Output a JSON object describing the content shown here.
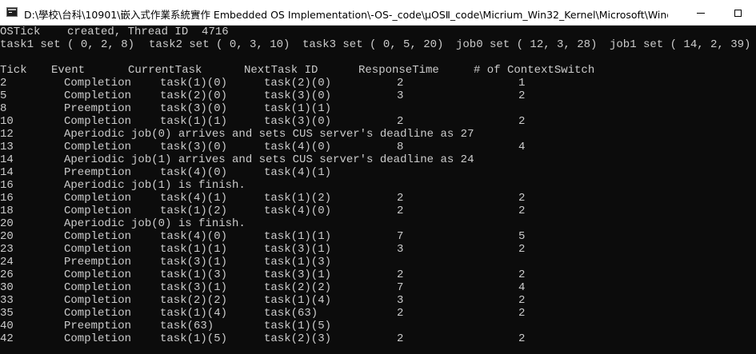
{
  "window": {
    "title": "D:\\學校\\台科\\10901\\嵌入式作業系統實作 Embedded OS Implementation\\-OS-_code\\μOSⅡ_code\\Micrium_Win32_Kernel\\Microsoft\\Windows\\..."
  },
  "console": {
    "header": {
      "ostick_line": "OSTick    created, Thread ID  4716",
      "tasks": [
        "task1 set ( 0, 2, 8)",
        "task2 set ( 0, 3, 10)",
        "task3 set ( 0, 5, 20)",
        "job0 set ( 12, 3, 28)",
        "job1 set ( 14, 2, 39)"
      ]
    },
    "columns": [
      "Tick",
      "Event",
      "CurrentTask",
      "NextTask ID",
      "ResponseTime",
      "# of ContextSwitch"
    ],
    "rows": [
      {
        "tick": "2",
        "event": "Completion",
        "current": "task(1)(0)",
        "next": "task(2)(0)",
        "response": "2",
        "switches": "1"
      },
      {
        "tick": "5",
        "event": "Completion",
        "current": "task(2)(0)",
        "next": "task(3)(0)",
        "response": "3",
        "switches": "2"
      },
      {
        "tick": "8",
        "event": "Preemption",
        "current": "task(3)(0)",
        "next": "task(1)(1)",
        "response": "",
        "switches": ""
      },
      {
        "tick": "10",
        "event": "Completion",
        "current": "task(1)(1)",
        "next": "task(3)(0)",
        "response": "2",
        "switches": "2"
      },
      {
        "tick": "12",
        "message": "Aperiodic job(0) arrives and sets CUS server's deadline as 27"
      },
      {
        "tick": "13",
        "event": "Completion",
        "current": "task(3)(0)",
        "next": "task(4)(0)",
        "response": "8",
        "switches": "4"
      },
      {
        "tick": "14",
        "message": "Aperiodic job(1) arrives and sets CUS server's deadline as 24"
      },
      {
        "tick": "14",
        "event": "Preemption",
        "current": "task(4)(0)",
        "next": "task(4)(1)",
        "response": "",
        "switches": ""
      },
      {
        "tick": "16",
        "message": "Aperiodic job(1) is finish."
      },
      {
        "tick": "16",
        "event": "Completion",
        "current": "task(4)(1)",
        "next": "task(1)(2)",
        "response": "2",
        "switches": "2"
      },
      {
        "tick": "18",
        "event": "Completion",
        "current": "task(1)(2)",
        "next": "task(4)(0)",
        "response": "2",
        "switches": "2"
      },
      {
        "tick": "20",
        "message": "Aperiodic job(0) is finish."
      },
      {
        "tick": "20",
        "event": "Completion",
        "current": "task(4)(0)",
        "next": "task(1)(1)",
        "response": "7",
        "switches": "5"
      },
      {
        "tick": "23",
        "event": "Completion",
        "current": "task(1)(1)",
        "next": "task(3)(1)",
        "response": "3",
        "switches": "2"
      },
      {
        "tick": "24",
        "event": "Preemption",
        "current": "task(3)(1)",
        "next": "task(1)(3)",
        "response": "",
        "switches": ""
      },
      {
        "tick": "26",
        "event": "Completion",
        "current": "task(1)(3)",
        "next": "task(3)(1)",
        "response": "2",
        "switches": "2"
      },
      {
        "tick": "30",
        "event": "Completion",
        "current": "task(3)(1)",
        "next": "task(2)(2)",
        "response": "7",
        "switches": "4"
      },
      {
        "tick": "33",
        "event": "Completion",
        "current": "task(2)(2)",
        "next": "task(1)(4)",
        "response": "3",
        "switches": "2"
      },
      {
        "tick": "35",
        "event": "Completion",
        "current": "task(1)(4)",
        "next": "task(63)",
        "response": "2",
        "switches": "2"
      },
      {
        "tick": "40",
        "event": "Preemption",
        "current": "task(63)",
        "next": "task(1)(5)",
        "response": "",
        "switches": ""
      },
      {
        "tick": "42",
        "event": "Completion",
        "current": "task(1)(5)",
        "next": "task(2)(3)",
        "response": "2",
        "switches": "2"
      }
    ]
  }
}
